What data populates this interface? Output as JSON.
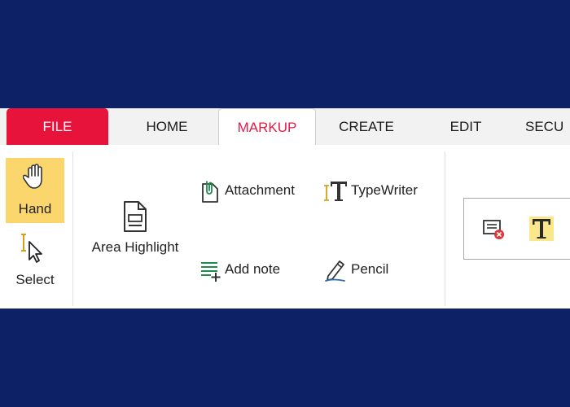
{
  "tabs": {
    "file": "FILE",
    "home": "HOME",
    "markup": "MARKUP",
    "create": "CREATE",
    "edit": "EDIT",
    "security": "SECU"
  },
  "tools": {
    "hand": "Hand",
    "select": "Select",
    "area_highlight": "Area Highlight",
    "attachment": "Attachment",
    "typewriter": "TypeWriter",
    "add_note": "Add note",
    "pencil": "Pencil"
  },
  "colors": {
    "background": "#0c2166",
    "file_tab": "#e8133b",
    "active_tab_text": "#e21b45",
    "hand_highlight": "#fbd66d"
  },
  "icons": {
    "hand": "hand-icon",
    "select": "select-cursor-icon",
    "area_highlight": "document-icon",
    "attachment": "paperclip-icon",
    "typewriter": "typewriter-icon",
    "add_note": "add-note-icon",
    "pencil": "pencil-icon",
    "remove_note": "remove-note-icon",
    "text_highlight": "text-highlight-icon"
  }
}
